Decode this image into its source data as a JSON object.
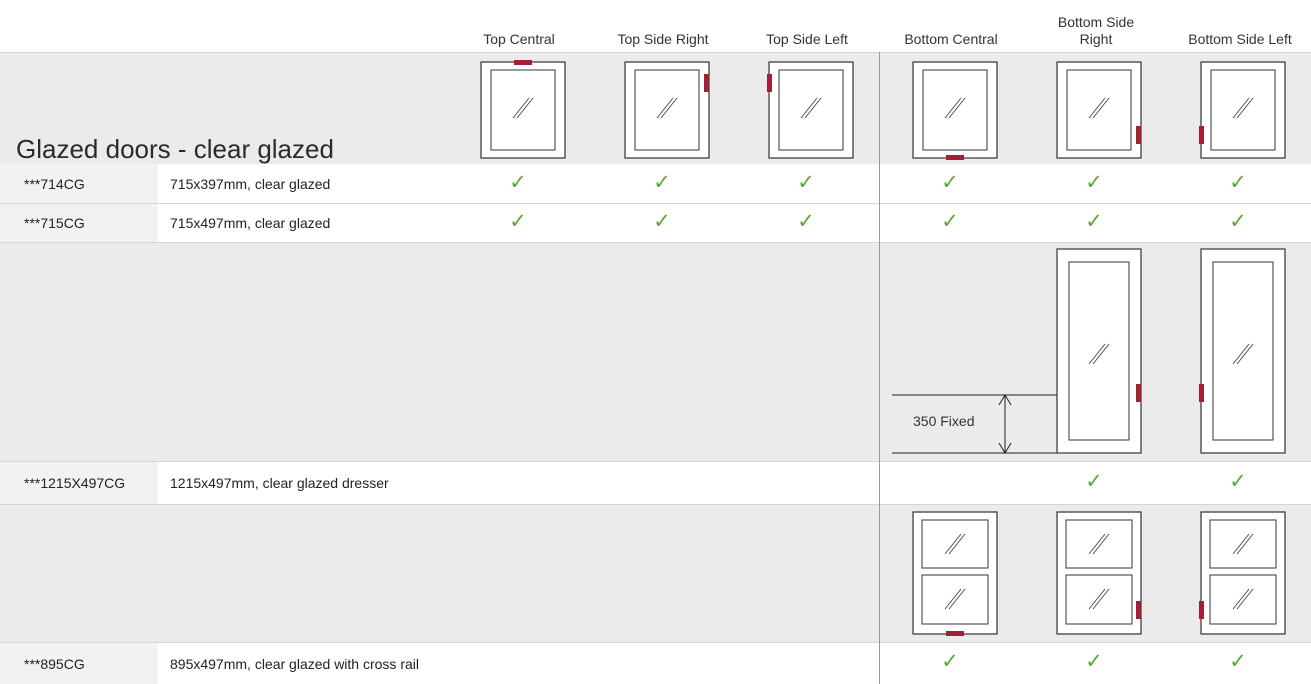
{
  "headers": [
    "Top Central",
    "Top Side Right",
    "Top Side Left",
    "Bottom Central",
    "Bottom Side Right",
    "Bottom Side Left"
  ],
  "section_title": "Glazed doors - clear glazed",
  "rows": [
    {
      "code": "***714CG",
      "desc": "715x397mm, clear glazed",
      "avail": [
        true,
        true,
        true,
        true,
        true,
        true
      ]
    },
    {
      "code": "***715CG",
      "desc": "715x497mm, clear glazed",
      "avail": [
        true,
        true,
        true,
        true,
        true,
        true
      ]
    },
    {
      "code": "***1215X497CG",
      "desc": "1215x497mm, clear glazed dresser",
      "avail": [
        false,
        false,
        false,
        false,
        true,
        true
      ]
    },
    {
      "code": "***895CG",
      "desc": "895x497mm, clear glazed with cross rail",
      "avail": [
        false,
        false,
        false,
        true,
        true,
        true
      ]
    }
  ],
  "tick_symbol": "✓",
  "dimension_label": "350 Fixed",
  "colors": {
    "hinge": "#a41e34",
    "tick": "#5aaa3a",
    "band": "#ebebeb",
    "code_bg": "#f2f2f2"
  }
}
